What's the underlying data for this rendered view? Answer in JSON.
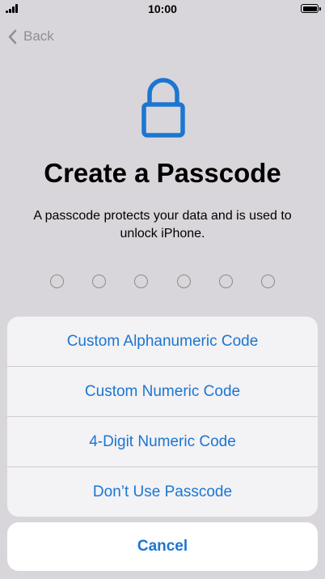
{
  "status_bar": {
    "time": "10:00",
    "signal_icon": "cellular-signal-icon",
    "battery_icon": "battery-icon"
  },
  "nav": {
    "back_label": "Back",
    "back_icon": "chevron-left-icon"
  },
  "header": {
    "icon": "lock-icon",
    "title": "Create a Passcode",
    "subtitle": "A passcode protects your data and is used to unlock iPhone."
  },
  "passcode": {
    "digit_count": 6,
    "entered": 0
  },
  "options_sheet": {
    "items": [
      {
        "label": "Custom Alphanumeric Code"
      },
      {
        "label": "Custom Numeric Code"
      },
      {
        "label": "4-Digit Numeric Code"
      },
      {
        "label": "Don’t Use Passcode"
      }
    ],
    "cancel_label": "Cancel"
  },
  "colors": {
    "accent": "#1b76d2",
    "background": "#d8d6da",
    "sheet": "#f3f2f4",
    "back_text": "#8e8e93"
  }
}
